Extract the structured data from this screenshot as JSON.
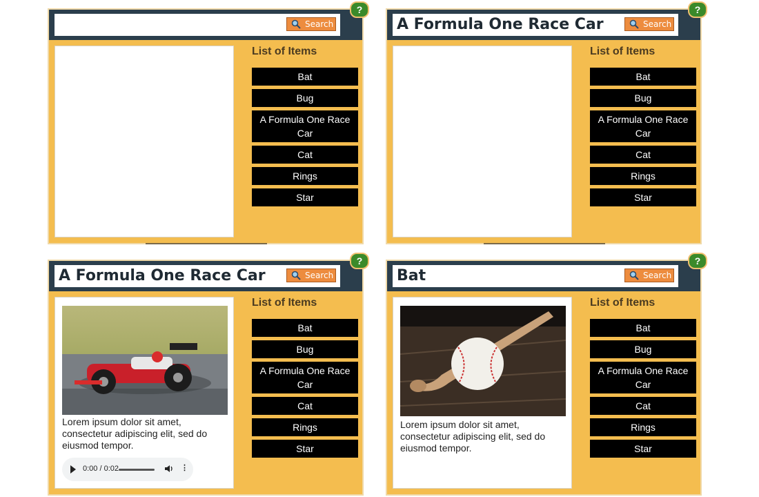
{
  "list_heading": "List of Items",
  "items": [
    "Bat",
    "Bug",
    "A Formula One Race Car",
    "Cat",
    "Rings",
    "Star"
  ],
  "search_label": "Search",
  "help_label": "?",
  "panels": [
    {
      "title": ""
    },
    {
      "title": "A Formula One Race Car"
    },
    {
      "title": "A Formula One Race Car",
      "description": "Lorem ipsum dolor sit amet, consectetur adipiscing elit, sed do eiusmod tempor.",
      "audio_time": "0:00 / 0:02"
    },
    {
      "title": "Bat",
      "description": "Lorem ipsum dolor sit amet, consectetur adipiscing elit, sed do eiusmod tempor."
    }
  ],
  "colors": {
    "panel": "#f4bd4f",
    "header": "#2b3e4c",
    "search_button": "#ed8c3e",
    "help_button": "#3a8a2a",
    "item_button": "#000000"
  },
  "icons": [
    "magnifier-icon",
    "question-icon",
    "play-icon",
    "volume-icon",
    "more-vert-icon"
  ]
}
